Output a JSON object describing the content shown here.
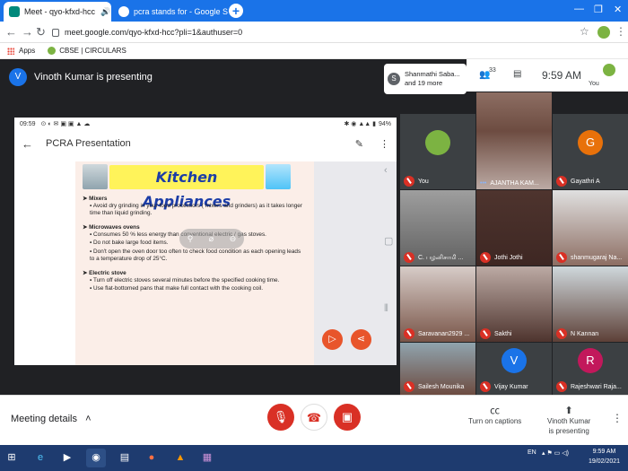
{
  "browser": {
    "tabs": [
      {
        "title": "Meet - qyo-kfxd-hcc",
        "audio_icon": "speaker-icon",
        "close": "✕"
      },
      {
        "title": "pcra stands for - Google Search",
        "close": "✕"
      }
    ],
    "url": "meet.google.com/qyo-kfxd-hcc?pli=1&authuser=0",
    "bookmarks": {
      "apps": "Apps",
      "item": "CBSE | CIRCULARS"
    }
  },
  "meet": {
    "presenter_initial": "V",
    "presenter_banner": "Vinoth Kumar is presenting",
    "participants_chip": {
      "initial": "S",
      "line1": "Shanmathi Saba...",
      "line2": "and 19 more"
    },
    "people_count": "33",
    "clock": "9:59 AM",
    "you_label": "You",
    "shared_screen": {
      "phone_time": "09:59",
      "battery": "94%",
      "app_title": "PCRA Presentation",
      "slide_title": "Kitchen Appliances",
      "sections": [
        {
          "heading": "Mixers",
          "bullets": [
            "Avoid dry grinding in your food processors ( mixers and grinders) as it takes longer time than liquid grinding."
          ]
        },
        {
          "heading": "Microwaves ovens",
          "bullets": [
            "Consumes 50 % less energy than conventional electric / gas stoves.",
            "Do not bake large food items.",
            "Don't open the oven door too often to check food condition as each opening leads to a temperature drop of 25°C."
          ]
        },
        {
          "heading": "Electric stove",
          "bullets": [
            "Turn off electric stoves several minutes before the specified cooking time.",
            "Use flat-bottomed pans that make full contact with the cooking coil."
          ]
        }
      ]
    },
    "participants": [
      {
        "name": "You",
        "kind": "logo"
      },
      {
        "name": "AJANTHA KAM...",
        "kind": "photo",
        "speaking": true
      },
      {
        "name": "Gayathri A",
        "kind": "initial",
        "initial": "G",
        "color": "#e8710a"
      },
      {
        "name": "C. பழனிசாமி ...",
        "kind": "photo"
      },
      {
        "name": "Jothi Jothi",
        "kind": "photo"
      },
      {
        "name": "shanmugaraj Na...",
        "kind": "photo"
      },
      {
        "name": "Saravanan2929 ...",
        "kind": "photo"
      },
      {
        "name": "Sakthi",
        "kind": "photo"
      },
      {
        "name": "N Kannan",
        "kind": "photo"
      },
      {
        "name": "Sailesh Mounika",
        "kind": "photo"
      },
      {
        "name": "Vijay Kumar",
        "kind": "initial",
        "initial": "V",
        "color": "#1a73e8"
      },
      {
        "name": "Rajeshwari Raja...",
        "kind": "initial",
        "initial": "R",
        "color": "#c2185b"
      }
    ]
  },
  "controls": {
    "meeting_details": "Meeting details",
    "captions": "Turn on captions",
    "presenting_line1": "Vinoth Kumar",
    "presenting_line2": "is presenting"
  },
  "taskbar": {
    "lang": "EN",
    "time": "9:59 AM",
    "date": "19/02/2021"
  }
}
